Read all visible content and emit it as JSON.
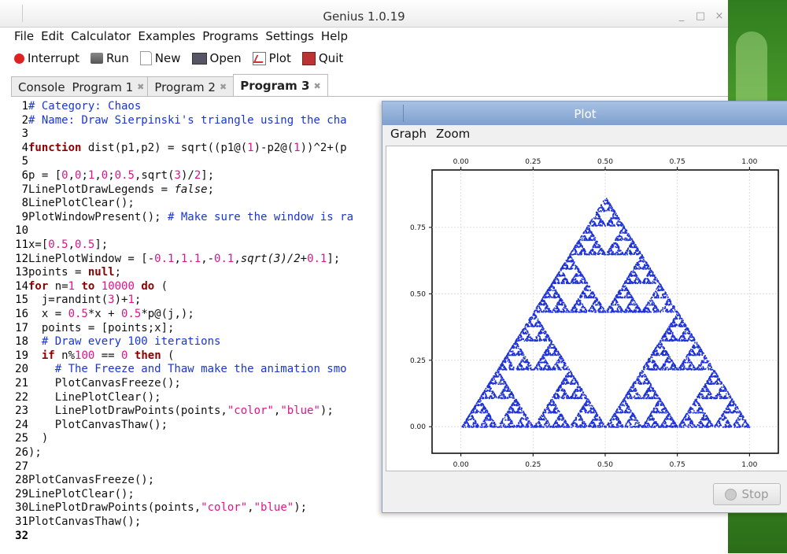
{
  "window": {
    "title": "Genius 1.0.19"
  },
  "menu": [
    "File",
    "Edit",
    "Calculator",
    "Examples",
    "Programs",
    "Settings",
    "Help"
  ],
  "toolbar": {
    "interrupt": "Interrupt",
    "run": "Run",
    "new": "New",
    "open": "Open",
    "plot": "Plot",
    "quit": "Quit"
  },
  "tabs": [
    "Console",
    "Program 1",
    "Program 2",
    "Program 3"
  ],
  "code": [
    {
      "n": "1",
      "parts": [
        [
          "c",
          "# Category: Chaos"
        ]
      ]
    },
    {
      "n": "2",
      "parts": [
        [
          "c",
          "# Name: Draw Sierpinski's triangle using the cha"
        ]
      ]
    },
    {
      "n": "3",
      "parts": []
    },
    {
      "n": "4",
      "parts": [
        [
          "k",
          "function"
        ],
        [
          "t",
          " dist(p1,p2) = sqrt((p1@("
        ],
        [
          "n",
          "1"
        ],
        [
          "t",
          ")-p2@("
        ],
        [
          "n",
          "1"
        ],
        [
          "t",
          "))^2+(p"
        ]
      ]
    },
    {
      "n": "5",
      "parts": []
    },
    {
      "n": "6",
      "parts": [
        [
          "t",
          "p = ["
        ],
        [
          "n",
          "0"
        ],
        [
          "t",
          ","
        ],
        [
          "n",
          "0"
        ],
        [
          "t",
          ";"
        ],
        [
          "n",
          "1"
        ],
        [
          "t",
          ","
        ],
        [
          "n",
          "0"
        ],
        [
          "t",
          ";"
        ],
        [
          "n",
          "0.5"
        ],
        [
          "t",
          ",sqrt("
        ],
        [
          "n",
          "3"
        ],
        [
          "t",
          ")/"
        ],
        [
          "n",
          "2"
        ],
        [
          "t",
          "];"
        ]
      ]
    },
    {
      "n": "7",
      "parts": [
        [
          "t",
          "LinePlotDrawLegends = "
        ],
        [
          "i",
          "false"
        ],
        [
          "t",
          ";"
        ]
      ]
    },
    {
      "n": "8",
      "parts": [
        [
          "t",
          "LinePlotClear();"
        ]
      ]
    },
    {
      "n": "9",
      "parts": [
        [
          "t",
          "PlotWindowPresent(); "
        ],
        [
          "c",
          "# Make sure the window is ra"
        ]
      ]
    },
    {
      "n": "10",
      "parts": []
    },
    {
      "n": "11",
      "parts": [
        [
          "t",
          "x=["
        ],
        [
          "n",
          "0.5"
        ],
        [
          "t",
          ","
        ],
        [
          "n",
          "0.5"
        ],
        [
          "t",
          "];"
        ]
      ]
    },
    {
      "n": "12",
      "parts": [
        [
          "t",
          "LinePlotWindow = [-"
        ],
        [
          "n",
          "0.1"
        ],
        [
          "t",
          ","
        ],
        [
          "n",
          "1.1"
        ],
        [
          "t",
          ",-"
        ],
        [
          "n",
          "0.1"
        ],
        [
          "t",
          ","
        ],
        [
          "i",
          "sqrt(3)/2"
        ],
        [
          "t",
          "+"
        ],
        [
          "n",
          "0.1"
        ],
        [
          "t",
          "];"
        ]
      ]
    },
    {
      "n": "13",
      "parts": [
        [
          "t",
          "points = "
        ],
        [
          "k",
          "null"
        ],
        [
          "t",
          ";"
        ]
      ]
    },
    {
      "n": "14",
      "parts": [
        [
          "k",
          "for"
        ],
        [
          "t",
          " n="
        ],
        [
          "n",
          "1"
        ],
        [
          "t",
          " "
        ],
        [
          "k",
          "to"
        ],
        [
          "t",
          " "
        ],
        [
          "n",
          "10000"
        ],
        [
          "t",
          " "
        ],
        [
          "k",
          "do"
        ],
        [
          "t",
          " ("
        ]
      ]
    },
    {
      "n": "15",
      "parts": [
        [
          "t",
          "  j=randint("
        ],
        [
          "n",
          "3"
        ],
        [
          "t",
          ")+"
        ],
        [
          "n",
          "1"
        ],
        [
          "t",
          ";"
        ]
      ]
    },
    {
      "n": "16",
      "parts": [
        [
          "t",
          "  x = "
        ],
        [
          "n",
          "0.5"
        ],
        [
          "t",
          "*x + "
        ],
        [
          "n",
          "0.5"
        ],
        [
          "t",
          "*p@(j,);"
        ]
      ]
    },
    {
      "n": "17",
      "parts": [
        [
          "t",
          "  points = [points;x];"
        ]
      ]
    },
    {
      "n": "18",
      "parts": [
        [
          "t",
          "  "
        ],
        [
          "c",
          "# Draw every 100 iterations"
        ]
      ]
    },
    {
      "n": "19",
      "parts": [
        [
          "t",
          "  "
        ],
        [
          "k",
          "if"
        ],
        [
          "t",
          " n%"
        ],
        [
          "n",
          "100"
        ],
        [
          "t",
          " == "
        ],
        [
          "n",
          "0"
        ],
        [
          "t",
          " "
        ],
        [
          "k",
          "then"
        ],
        [
          "t",
          " ("
        ]
      ]
    },
    {
      "n": "20",
      "parts": [
        [
          "t",
          "    "
        ],
        [
          "c",
          "# The Freeze and Thaw make the animation smo"
        ]
      ]
    },
    {
      "n": "21",
      "parts": [
        [
          "t",
          "    PlotCanvasFreeze();"
        ]
      ]
    },
    {
      "n": "22",
      "parts": [
        [
          "t",
          "    LinePlotClear();"
        ]
      ]
    },
    {
      "n": "23",
      "parts": [
        [
          "t",
          "    LinePlotDrawPoints(points,"
        ],
        [
          "s",
          "\"color\""
        ],
        [
          "t",
          ","
        ],
        [
          "s",
          "\"blue\""
        ],
        [
          "t",
          ");"
        ]
      ]
    },
    {
      "n": "24",
      "parts": [
        [
          "t",
          "    PlotCanvasThaw();"
        ]
      ]
    },
    {
      "n": "25",
      "parts": [
        [
          "t",
          "  )"
        ]
      ]
    },
    {
      "n": "26",
      "parts": [
        [
          "t",
          ");"
        ]
      ]
    },
    {
      "n": "27",
      "parts": []
    },
    {
      "n": "28",
      "parts": [
        [
          "t",
          "PlotCanvasFreeze();"
        ]
      ]
    },
    {
      "n": "29",
      "parts": [
        [
          "t",
          "LinePlotClear();"
        ]
      ]
    },
    {
      "n": "30",
      "parts": [
        [
          "t",
          "LinePlotDrawPoints(points,"
        ],
        [
          "s",
          "\"color\""
        ],
        [
          "t",
          ","
        ],
        [
          "s",
          "\"blue\""
        ],
        [
          "t",
          ");"
        ]
      ]
    },
    {
      "n": "31",
      "parts": [
        [
          "t",
          "PlotCanvasThaw();"
        ]
      ]
    },
    {
      "n": "32",
      "parts": []
    }
  ],
  "plot": {
    "title": "Plot",
    "menu": [
      "Graph",
      "Zoom"
    ],
    "stop_label": "Stop",
    "x_ticks": [
      "0.00",
      "0.25",
      "0.50",
      "0.75",
      "1.00"
    ],
    "y_ticks": [
      "0.00",
      "0.25",
      "0.50",
      "0.75"
    ],
    "point_color": "#1b2fd6"
  },
  "chart_data": {
    "type": "scatter",
    "xlim": [
      -0.1,
      1.1
    ],
    "ylim": [
      -0.1,
      0.966
    ],
    "x_ticks": [
      0,
      0.25,
      0.5,
      0.75,
      1.0
    ],
    "y_ticks": [
      0,
      0.25,
      0.5,
      0.75
    ],
    "series": [
      {
        "vertices": [
          [
            0,
            0
          ],
          [
            1,
            0
          ],
          [
            0.5,
            0.866
          ]
        ],
        "iterations": 10000,
        "color": "#1b2fd6"
      }
    ],
    "grid": true
  }
}
